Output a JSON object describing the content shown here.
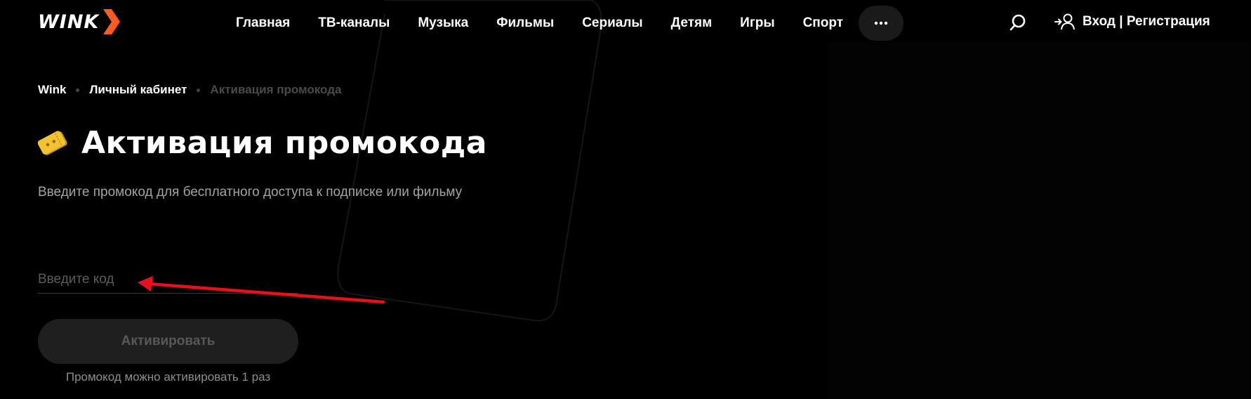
{
  "header": {
    "logo_text": "WINK",
    "nav": [
      "Главная",
      "ТВ-каналы",
      "Музыка",
      "Фильмы",
      "Сериалы",
      "Детям",
      "Игры",
      "Спорт"
    ],
    "login_label": "Вход | Регистрация"
  },
  "breadcrumb": {
    "items": [
      "Wink",
      "Личный кабинет"
    ],
    "current": "Активация промокода"
  },
  "page": {
    "title": "Активация промокода",
    "subtitle": "Введите промокод для бесплатного доступа к подписке или фильму"
  },
  "form": {
    "code_placeholder": "Введите код",
    "code_value": "",
    "activate_label": "Активировать",
    "hint": "Промокод можно активировать 1 раз"
  },
  "colors": {
    "accent": "#ff5a1f",
    "annotation_arrow": "#e8101a",
    "ticket_icon": "#f2c230"
  },
  "icons": [
    "chevron-arrow-logo-icon",
    "more-dots-icon",
    "search-icon",
    "user-login-icon",
    "ticket-icon"
  ]
}
